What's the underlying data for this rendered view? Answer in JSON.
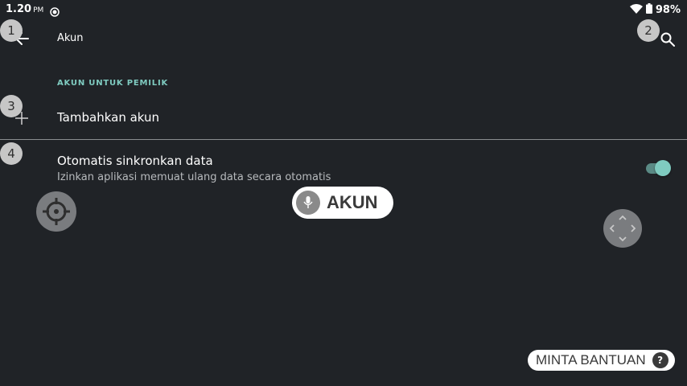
{
  "status_bar": {
    "time": "1.20",
    "ampm": "PM",
    "battery": "98%",
    "icons": [
      "data-saver-icon",
      "wifi-icon",
      "battery-icon"
    ]
  },
  "app_bar": {
    "title": "Akun",
    "back_icon": "arrow-left-icon",
    "search_icon": "search-icon"
  },
  "list": {
    "section_header": "AKUN UNTUK PEMILIK",
    "add_account_label": "Tambahkan akun",
    "sync": {
      "title": "Otomatis sinkronkan data",
      "subtitle": "Izinkan aplikasi memuat ulang data secara otomatis",
      "enabled": true
    }
  },
  "overlay": {
    "badges": [
      "1",
      "2",
      "3",
      "4"
    ],
    "voice_label": "AKUN",
    "help_label": "MINTA BANTUAN",
    "help_icon_text": "?"
  },
  "colors": {
    "background": "#202327",
    "accent": "#7fcbc0",
    "text_primary": "#ffffff",
    "text_secondary": "#b7babd"
  }
}
